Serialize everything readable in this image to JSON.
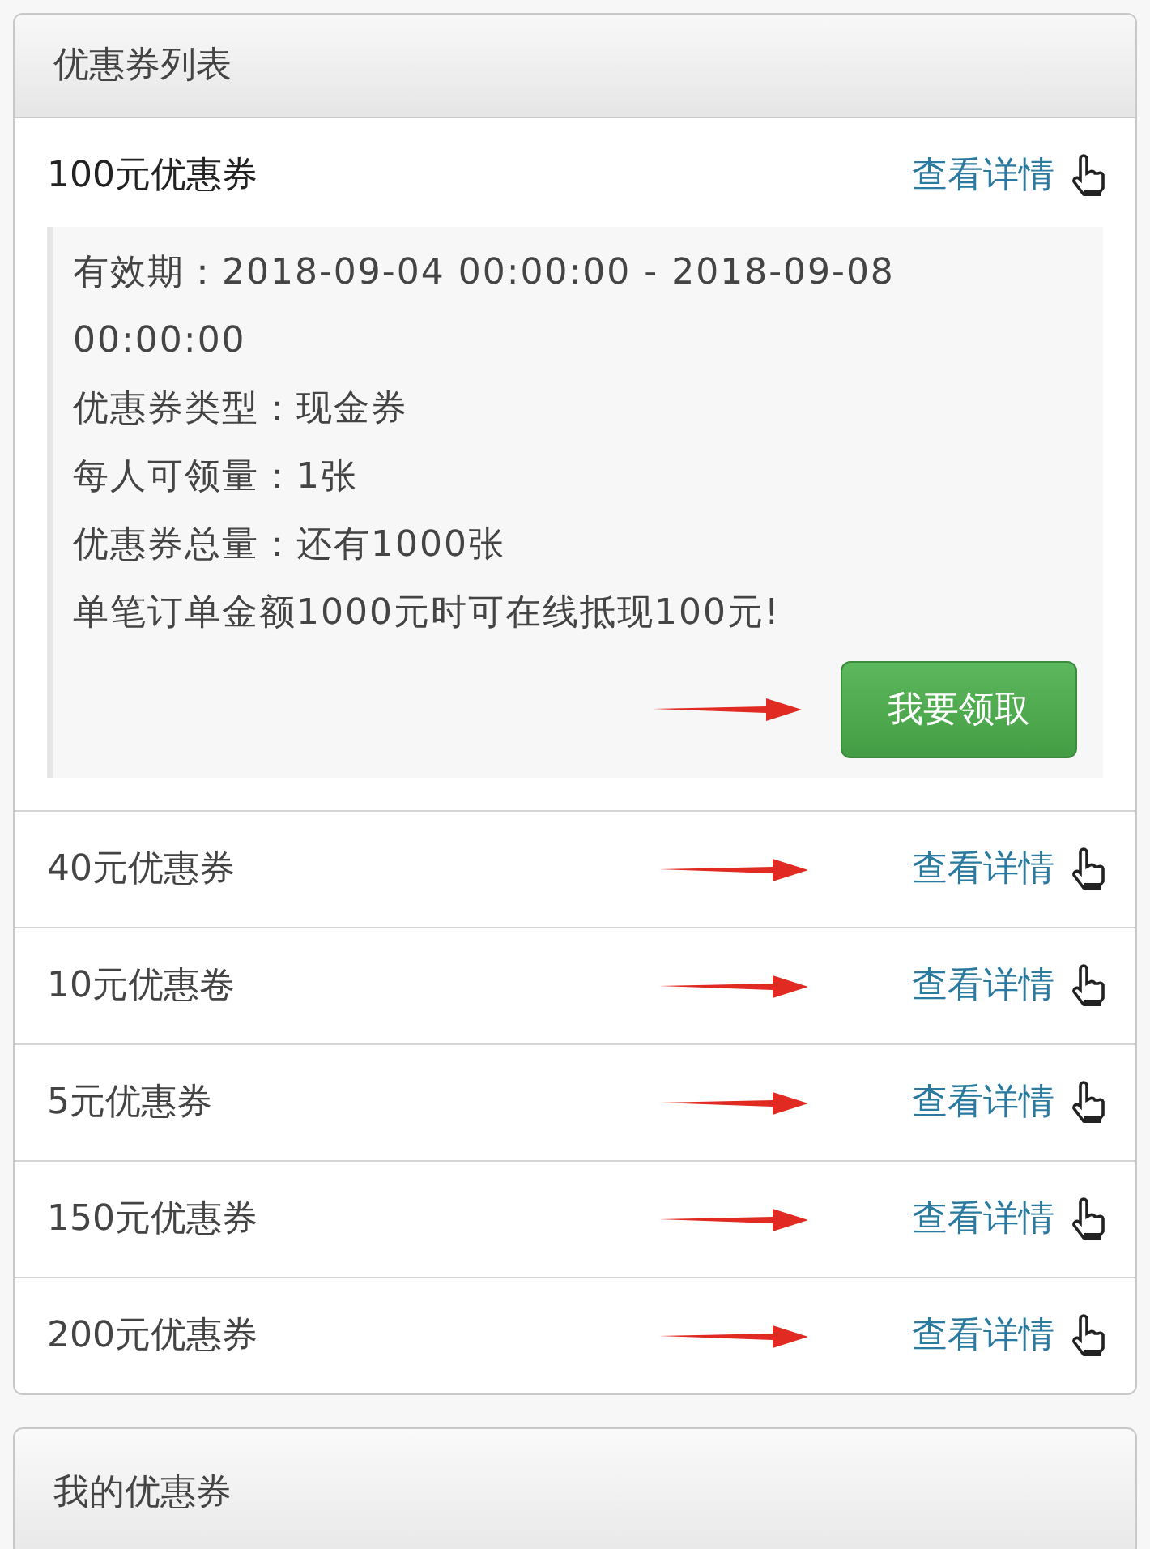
{
  "coupon_list": {
    "title": "优惠券列表",
    "items": [
      {
        "name": "100元优惠券",
        "link": "查看详情",
        "expanded": true,
        "annotated": false,
        "details": [
          "有效期：2018-09-04 00:00:00 - 2018-09-08 00:00:00",
          "优惠券类型：现金券",
          "每人可领量：1张",
          "优惠券总量：还有1000张",
          "单笔订单金额1000元时可在线抵现100元!"
        ],
        "button": {
          "label": "我要领取",
          "annotated": true
        }
      },
      {
        "name": "40元优惠券",
        "link": "查看详情",
        "expanded": false,
        "annotated": true
      },
      {
        "name": "10元优惠卷",
        "link": "查看详情",
        "expanded": false,
        "annotated": true
      },
      {
        "name": "5元优惠券",
        "link": "查看详情",
        "expanded": false,
        "annotated": true
      },
      {
        "name": "150元优惠券",
        "link": "查看详情",
        "expanded": false,
        "annotated": true
      },
      {
        "name": "200元优惠券",
        "link": "查看详情",
        "expanded": false,
        "annotated": true
      }
    ]
  },
  "my_coupons": {
    "title": "我的优惠券"
  }
}
